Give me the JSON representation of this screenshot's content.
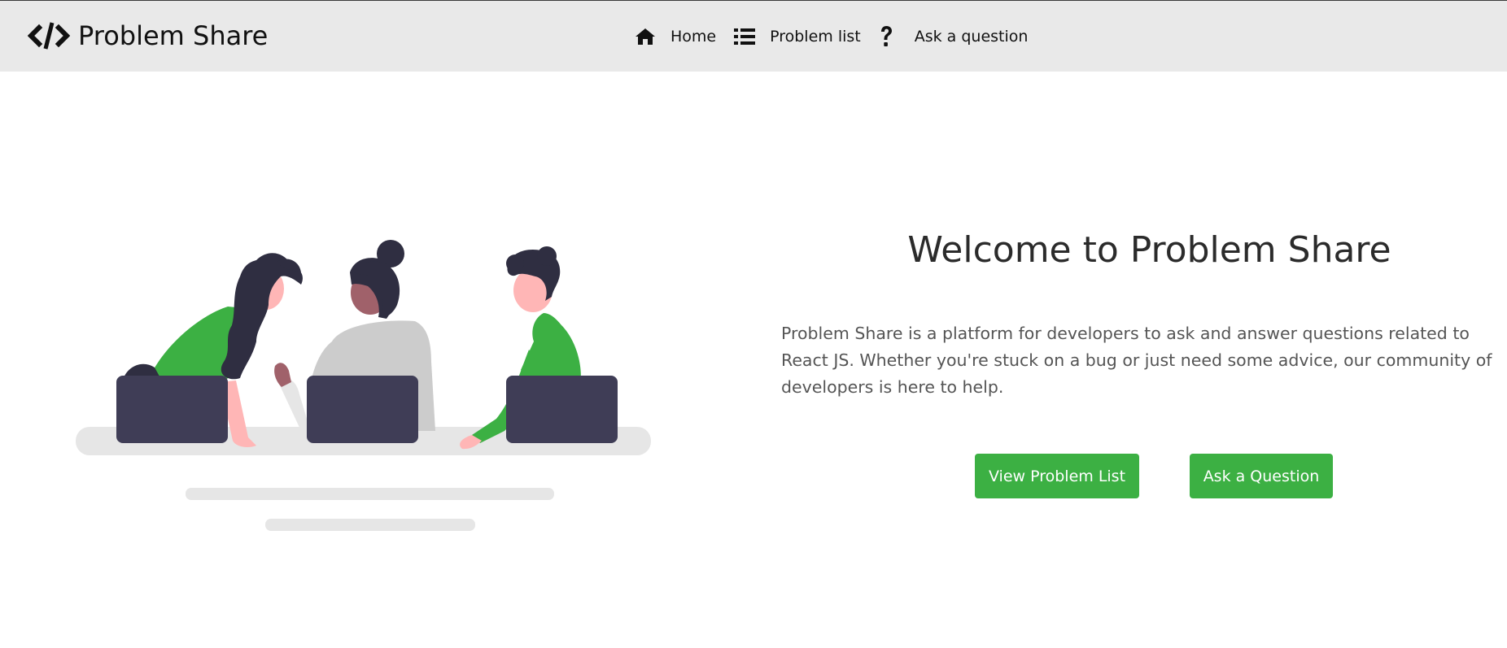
{
  "navbar": {
    "brand_name": "Problem Share",
    "brand_icon": "code-slash-icon",
    "links": [
      {
        "label": "Home",
        "icon": "home-icon"
      },
      {
        "label": "Problem list",
        "icon": "list-icon"
      },
      {
        "label": "Ask a question",
        "icon": "question-icon"
      }
    ]
  },
  "hero": {
    "title": "Welcome to Problem Share",
    "description": "Problem Share is a platform for developers to ask and answer questions related to React JS. Whether you're stuck on a bug or just need some advice, our community of developers is here to help.",
    "buttons": {
      "view_list": "View Problem List",
      "ask_question": "Ask a Question"
    }
  },
  "colors": {
    "navbar_bg": "#e9e9e9",
    "accent_green": "#3cb043",
    "laptop": "#3f3d56",
    "hair": "#2f2e41",
    "skin_light": "#ffb6b6",
    "skin_dark": "#a0616a",
    "shirt_grey": "#cccccc"
  }
}
